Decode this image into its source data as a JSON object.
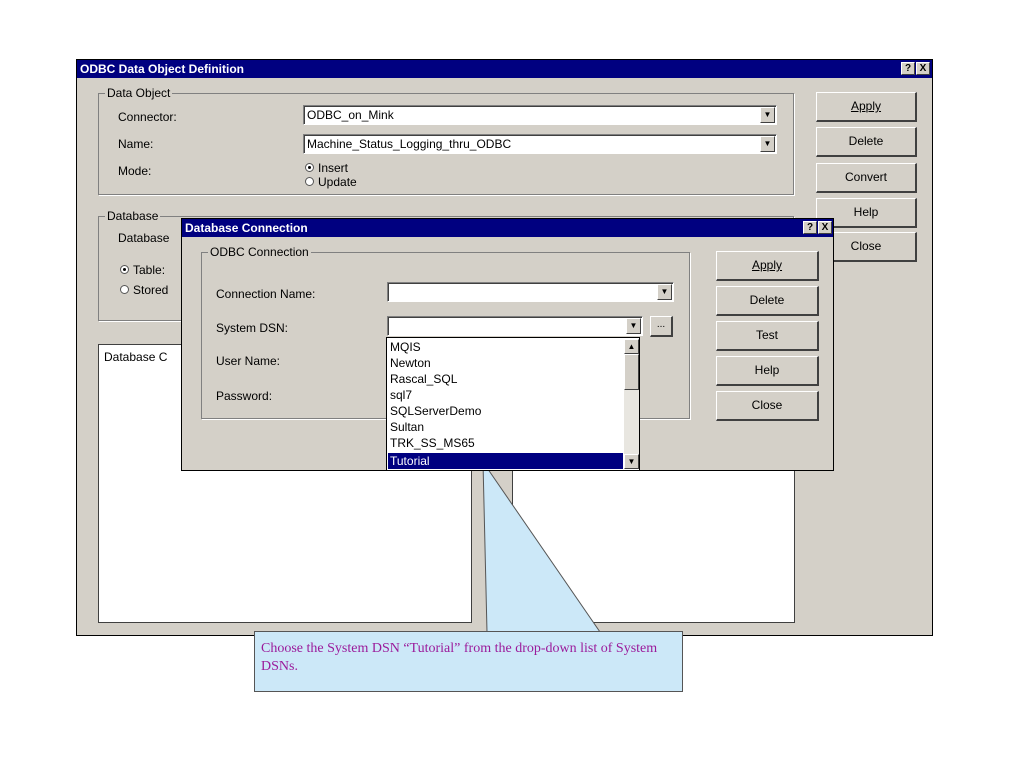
{
  "outer_dialog": {
    "title": "ODBC Data Object Definition",
    "help_glyph": "?",
    "close_glyph": "X",
    "data_object_group": {
      "label": "Data Object",
      "connector_label": "Connector:",
      "connector_value": "ODBC_on_Mink",
      "name_label": "Name:",
      "name_value": "Machine_Status_Logging_thru_ODBC",
      "mode_label": "Mode:",
      "mode_options": [
        "Insert",
        "Update"
      ],
      "mode_selected": "Insert"
    },
    "database_group": {
      "label": "Database",
      "database_label": "Database",
      "options": [
        "Table:",
        "Stored"
      ],
      "selected": "Table:"
    },
    "list_header": "Database C",
    "buttons": {
      "apply": "Apply",
      "delete": "Delete",
      "convert": "Convert",
      "help": "Help",
      "close": "Close"
    }
  },
  "connection_dialog": {
    "title": "Database Connection",
    "help_glyph": "?",
    "close_glyph": "X",
    "group_label": "ODBC Connection",
    "connection_name_label": "Connection Name:",
    "connection_name_value": "",
    "system_dsn_label": "System DSN:",
    "system_dsn_value": "",
    "browse_label": "...",
    "user_name_label": "User Name:",
    "password_label": "Password:",
    "buttons": {
      "apply": "Apply",
      "delete": "Delete",
      "test": "Test",
      "help": "Help",
      "close": "Close"
    }
  },
  "dsn_dropdown": {
    "items": [
      "MQIS",
      "Newton",
      "Rascal_SQL",
      "sql7",
      "SQLServerDemo",
      "Sultan",
      "TRK_SS_MS65",
      "Tutorial"
    ],
    "selected": "Tutorial"
  },
  "callout": {
    "text": "Choose the System DSN “Tutorial” from the drop-down list of System DSNs."
  },
  "colors": {
    "title_bar": "#000080",
    "dialog_face": "#d4d0c8",
    "selection": "#000080",
    "callout_fill": "#cce8f8",
    "callout_text": "#9b1b9b"
  }
}
